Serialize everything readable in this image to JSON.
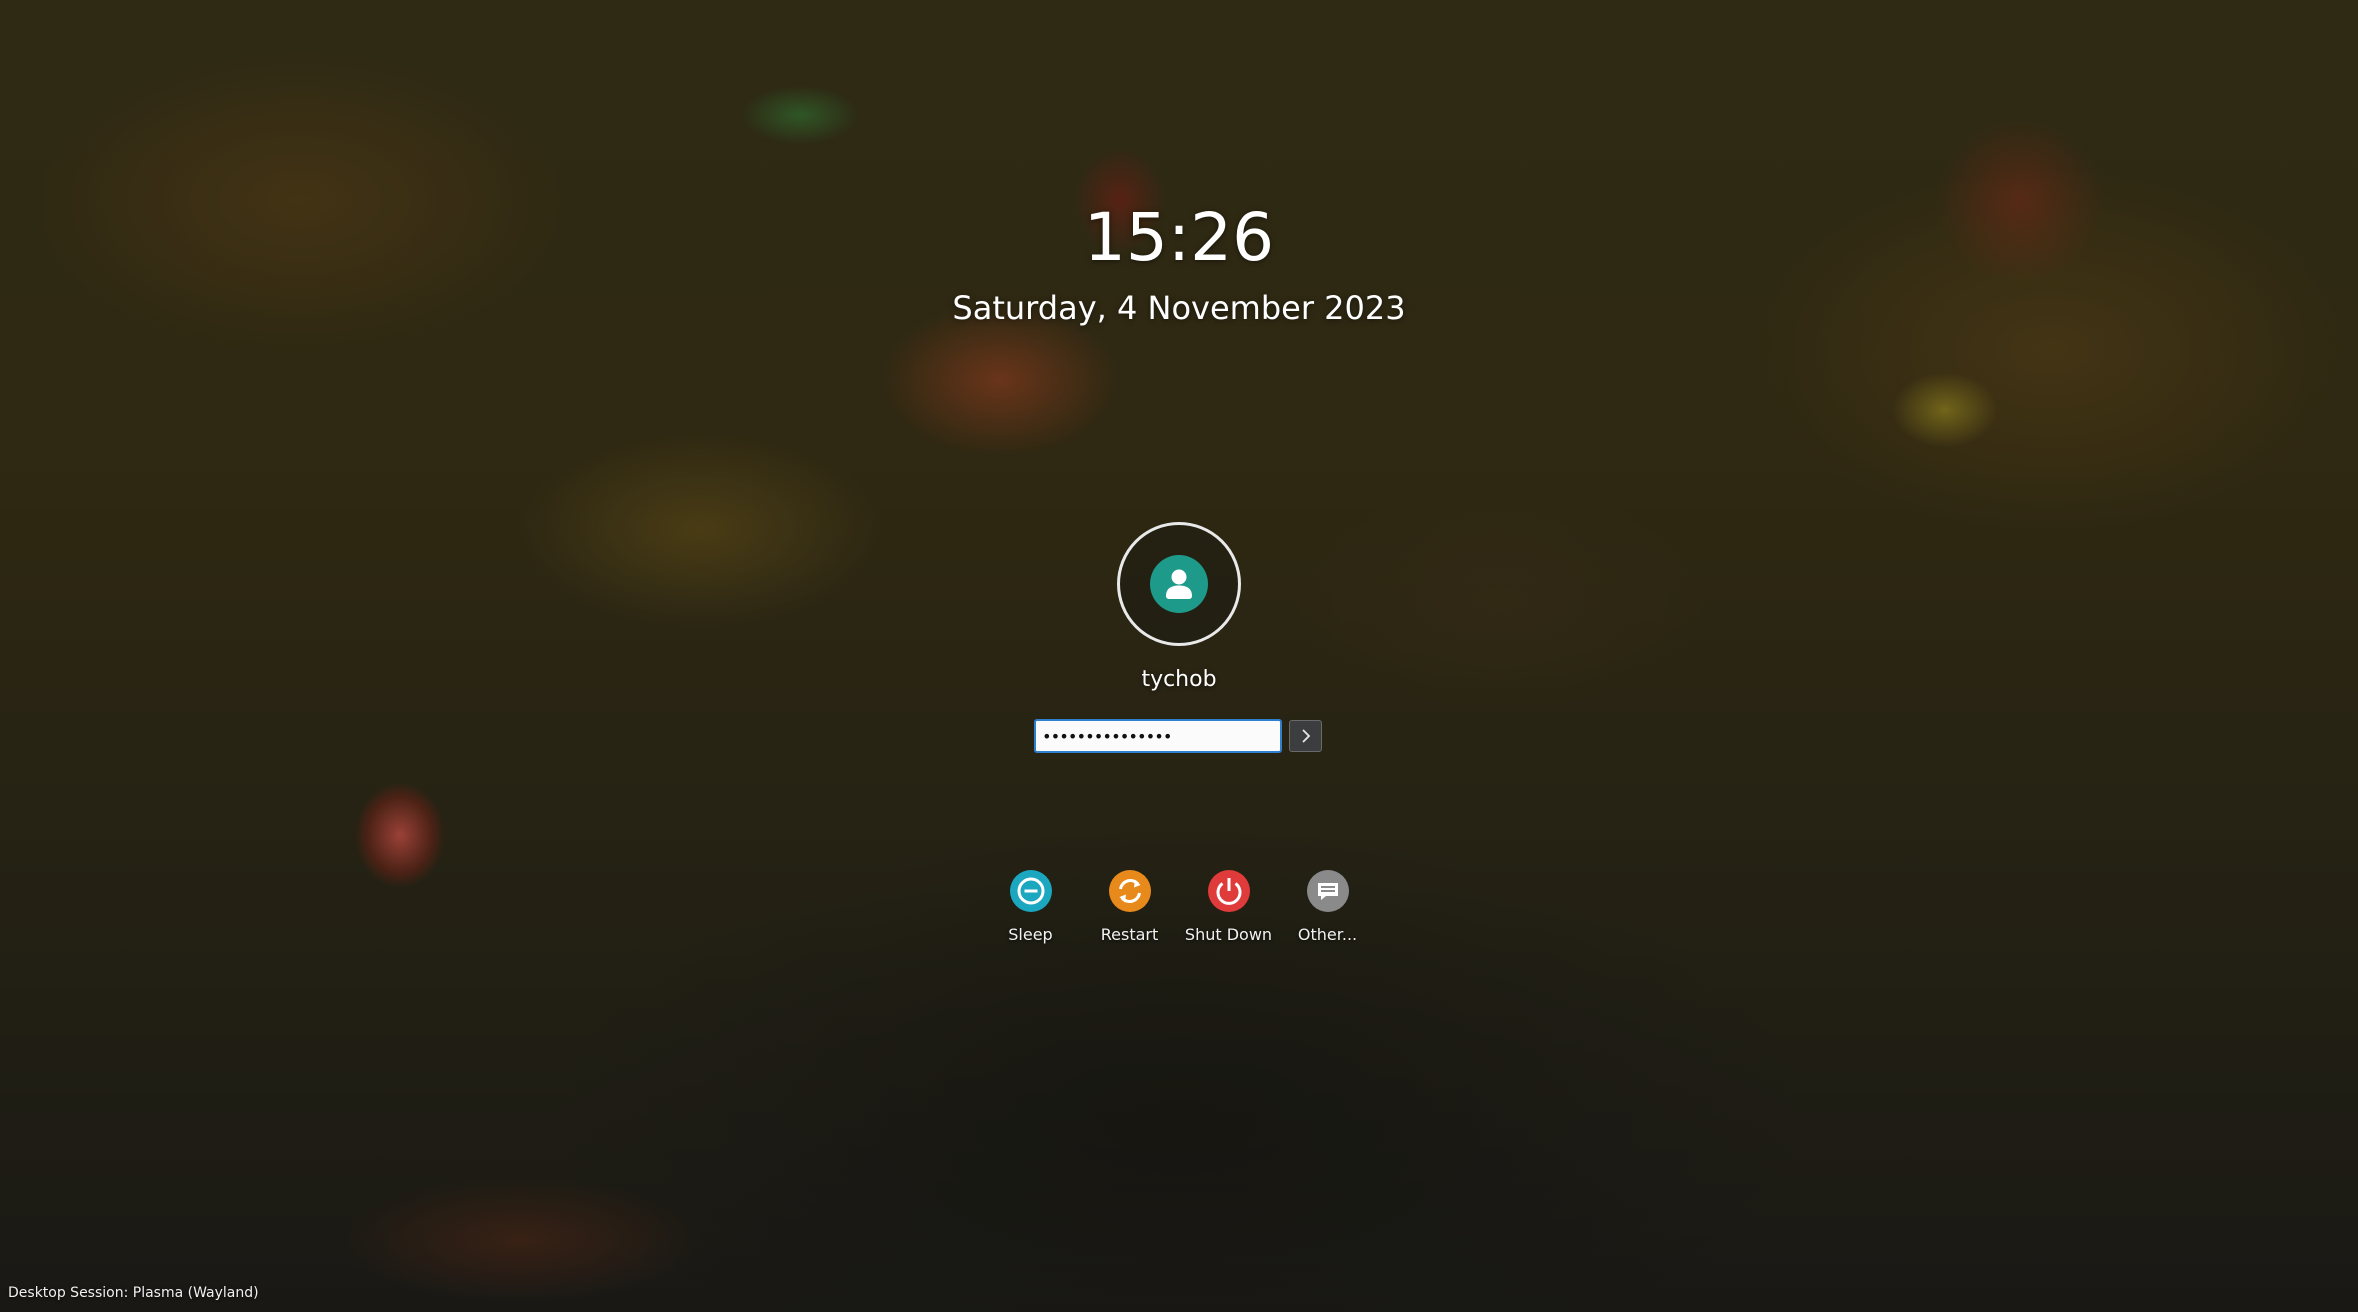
{
  "clock": {
    "time": "15:26",
    "date": "Saturday, 4 November 2023"
  },
  "user": {
    "name": "tychob",
    "avatar_icon": "user-avatar-icon",
    "avatar_color": "#1e9a8a"
  },
  "login": {
    "password_value": "•••••••••••••••",
    "submit_icon": "chevron-right-icon"
  },
  "actions": [
    {
      "label": "Sleep",
      "icon": "sleep-icon",
      "color": "#1aa7bf"
    },
    {
      "label": "Restart",
      "icon": "restart-icon",
      "color": "#e8891c"
    },
    {
      "label": "Shut Down",
      "icon": "power-icon",
      "color": "#df3b3b"
    },
    {
      "label": "Other...",
      "icon": "menu-icon",
      "color": "#8a8a8a"
    }
  ],
  "session": {
    "text": "Desktop Session: Plasma (Wayland)"
  }
}
